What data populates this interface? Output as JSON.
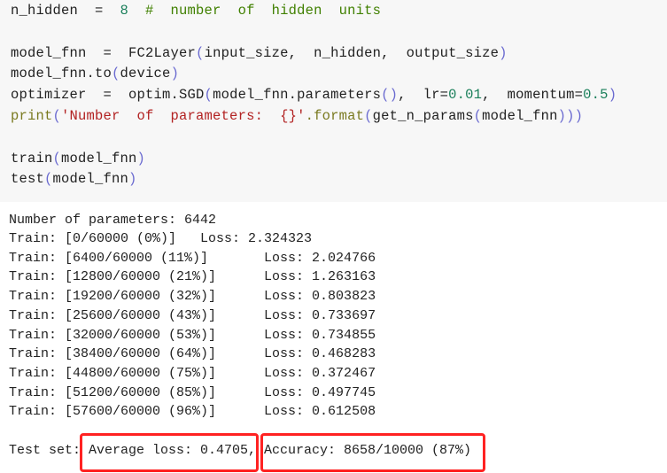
{
  "code_lines": [
    [
      {
        "t": "n_hidden  =  ",
        "c": "kw"
      },
      {
        "t": "8",
        "c": "num"
      },
      {
        "t": "  #  number  of  hidden  units",
        "c": "com"
      }
    ],
    [
      {
        "t": "model_fnn  =  FC2Layer",
        "c": "kw"
      },
      {
        "t": "(",
        "c": "par"
      },
      {
        "t": "input_size,  n_hidden,  output_size",
        "c": "kw"
      },
      {
        "t": ")",
        "c": "par"
      }
    ],
    [
      {
        "t": "model_fnn.to",
        "c": "kw"
      },
      {
        "t": "(",
        "c": "par"
      },
      {
        "t": "device",
        "c": "kw"
      },
      {
        "t": ")",
        "c": "par"
      }
    ],
    [
      {
        "t": "optimizer  =  optim.SGD",
        "c": "kw"
      },
      {
        "t": "(",
        "c": "par"
      },
      {
        "t": "model_fnn.parameters",
        "c": "kw"
      },
      {
        "t": "()",
        "c": "par"
      },
      {
        "t": ",  lr=",
        "c": "kw"
      },
      {
        "t": "0.01",
        "c": "num"
      },
      {
        "t": ",  momentum=",
        "c": "kw"
      },
      {
        "t": "0.5",
        "c": "num"
      },
      {
        "t": ")",
        "c": "par"
      }
    ],
    [
      {
        "t": "print",
        "c": "bi"
      },
      {
        "t": "(",
        "c": "par"
      },
      {
        "t": "'Number  of  parameters:  {}'",
        "c": "str"
      },
      {
        "t": ".format",
        "c": "bi"
      },
      {
        "t": "(",
        "c": "par"
      },
      {
        "t": "get_n_params",
        "c": "kw"
      },
      {
        "t": "(",
        "c": "par"
      },
      {
        "t": "model_fnn",
        "c": "kw"
      },
      {
        "t": ")))",
        "c": "par"
      }
    ],
    [
      {
        "t": "train",
        "c": "kw"
      },
      {
        "t": "(",
        "c": "par"
      },
      {
        "t": "model_fnn",
        "c": "kw"
      },
      {
        "t": ")",
        "c": "par"
      }
    ],
    [
      {
        "t": "test",
        "c": "kw"
      },
      {
        "t": "(",
        "c": "par"
      },
      {
        "t": "model_fnn",
        "c": "kw"
      },
      {
        "t": ")",
        "c": "par"
      }
    ]
  ],
  "output": {
    "params_line": "Number of parameters: 6442",
    "train_lines": [
      "Train: [0/60000 (0%)]   Loss: 2.324323",
      "Train: [6400/60000 (11%)]       Loss: 2.024766",
      "Train: [12800/60000 (21%)]      Loss: 1.263163",
      "Train: [19200/60000 (32%)]      Loss: 0.803823",
      "Train: [25600/60000 (43%)]      Loss: 0.733697",
      "Train: [32000/60000 (53%)]      Loss: 0.734855",
      "Train: [38400/60000 (64%)]      Loss: 0.468283",
      "Train: [44800/60000 (75%)]      Loss: 0.372467",
      "Train: [51200/60000 (85%)]      Loss: 0.497745",
      "Train: [57600/60000 (96%)]      Loss: 0.612508"
    ],
    "test_prefix": "Test set:",
    "avg_loss": "Average loss: 0.4705,",
    "accuracy": "Accuracy: 8658/10000 (87%)"
  },
  "highlight_color": "#ff2222"
}
